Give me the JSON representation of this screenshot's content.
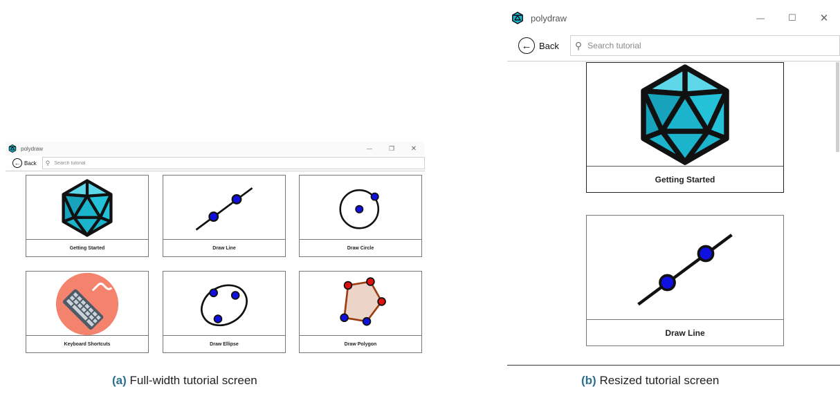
{
  "app": {
    "title": "polydraw"
  },
  "window_controls": {
    "minimize": "—",
    "maximize": "☐",
    "restore": "❐",
    "close": "✕"
  },
  "nav": {
    "back_label": "Back",
    "back_glyph": "←",
    "search_placeholder": "Search tutorial"
  },
  "tutorials": [
    {
      "label": "Getting Started",
      "icon": "icosahedron-icon"
    },
    {
      "label": "Draw Line",
      "icon": "line-icon"
    },
    {
      "label": "Draw Circle",
      "icon": "circle-icon"
    },
    {
      "label": "Keyboard Shortcuts",
      "icon": "keyboard-icon"
    },
    {
      "label": "Draw Ellipse",
      "icon": "ellipse-icon"
    },
    {
      "label": "Draw Polygon",
      "icon": "polygon-icon"
    }
  ],
  "captions": {
    "a_tag": "(a)",
    "a_text": "Full-width tutorial screen",
    "b_tag": "(b)",
    "b_text": "Resized tutorial screen"
  },
  "colors": {
    "teal": "#1fb6cf",
    "point_blue": "#1010e0",
    "point_red": "#e01010",
    "keyboard_bg": "#f4836e",
    "polygon_fill": "#ecd5c8"
  }
}
